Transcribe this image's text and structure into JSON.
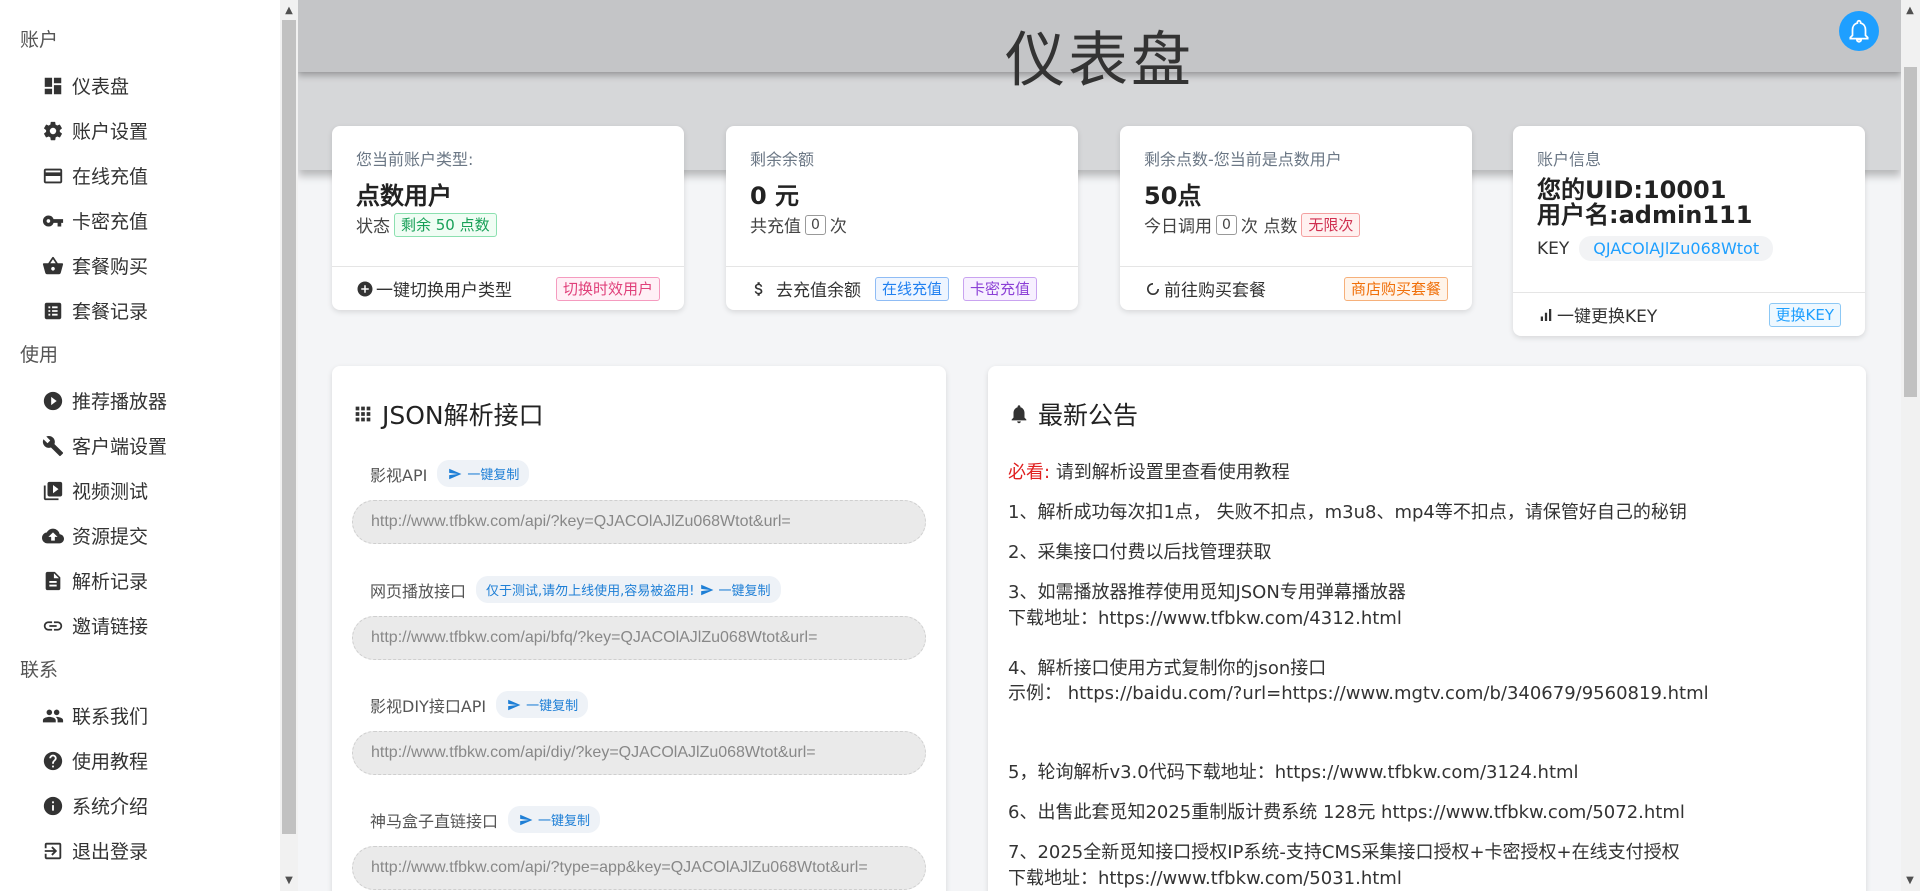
{
  "sidebar": {
    "sections": [
      {
        "label": "账户",
        "items": [
          {
            "label": "仪表盘",
            "icon": "dashboard-icon"
          },
          {
            "label": "账户设置",
            "icon": "gear-icon"
          },
          {
            "label": "在线充值",
            "icon": "credit-card-icon"
          },
          {
            "label": "卡密充值",
            "icon": "key-icon"
          },
          {
            "label": "套餐购买",
            "icon": "shopping-basket-icon"
          },
          {
            "label": "套餐记录",
            "icon": "list-icon"
          }
        ]
      },
      {
        "label": "使用",
        "items": [
          {
            "label": "推荐播放器",
            "icon": "play-circle-icon"
          },
          {
            "label": "客户端设置",
            "icon": "wrench-icon"
          },
          {
            "label": "视频测试",
            "icon": "video-library-icon"
          },
          {
            "label": "资源提交",
            "icon": "cloud-upload-icon"
          },
          {
            "label": "解析记录",
            "icon": "document-icon"
          },
          {
            "label": "邀请链接",
            "icon": "link-icon"
          }
        ]
      },
      {
        "label": "联系",
        "items": [
          {
            "label": "联系我们",
            "icon": "people-icon"
          },
          {
            "label": "使用教程",
            "icon": "help-circle-icon"
          },
          {
            "label": "系统介绍",
            "icon": "info-icon"
          },
          {
            "label": "退出登录",
            "icon": "logout-icon"
          }
        ]
      }
    ]
  },
  "header": {
    "title": "仪表盘",
    "bell_icon": "bell-icon"
  },
  "cards": {
    "type": {
      "caption": "您当前账户类型:",
      "value": "点数用户",
      "status_label": "状态",
      "status_tag": "剩余 50 点数",
      "action": "一键切换用户类型",
      "action_tag": "切换时效用户"
    },
    "balance": {
      "caption": "剩余余额",
      "value": "0 元",
      "line_prefix": "共充值",
      "count": "0",
      "line_suffix": "次",
      "action": "去充值余额",
      "tag1": "在线充值",
      "tag2": "卡密充值"
    },
    "points": {
      "caption": "剩余点数-您当前是点数用户",
      "value": "50点",
      "line_prefix": "今日调用",
      "count": "0",
      "line_suffix": "次 点数",
      "unlimited_tag": "无限次",
      "action": "前往购买套餐",
      "action_tag": "商店购买套餐"
    },
    "account": {
      "caption": "账户信息",
      "uid": "您的UID:10001",
      "username": "用户名:admin111",
      "key_label": "KEY",
      "key_value": "QJACOlAJlZu068Wtot",
      "action": "一键更换KEY",
      "action_tag": "更换KEY"
    }
  },
  "json_panel": {
    "title": "JSON解析接口",
    "copy_label": "一键复制",
    "apis": [
      {
        "label": "影视API",
        "note": "",
        "url": "http://www.tfbkw.com/api/?key=QJACOlAJlZu068Wtot&url="
      },
      {
        "label": "网页播放接口",
        "note": "仅于测试,请勿上线使用,容易被盗用!",
        "url": "http://www.tfbkw.com/api/bfq/?key=QJACOlAJlZu068Wtot&url="
      },
      {
        "label": "影视DIY接口API",
        "note": "",
        "url": "http://www.tfbkw.com/api/diy/?key=QJACOlAJlZu068Wtot&url="
      },
      {
        "label": "神马盒子直链接口",
        "note": "",
        "url": "http://www.tfbkw.com/api/?type=app&key=QJACOlAJlZu068Wtot&url="
      }
    ]
  },
  "announcements": {
    "title": "最新公告",
    "must_label": "必看:",
    "must_text": "请到解析设置里查看使用教程",
    "lines": [
      "1、解析成功每次扣1点， 失败不扣点，m3u8、mp4等不扣点，请保管好自己的秘钥",
      "2、采集接口付费以后找管理获取",
      "3、如需播放器推荐使用觅知JSON专用弹幕播放器",
      "下载地址：https://www.tfbkw.com/4312.html",
      "4、解析接口使用方式复制你的json接口",
      "示例： https://baidu.com/?url=https://www.mgtv.com/b/340679/9560819.html",
      "5，轮询解析v3.0代码下载地址：https://www.tfbkw.com/3124.html",
      "6、出售此套觅知2025重制版计费系统 128元 https://www.tfbkw.com/5072.html",
      "7、2025全新觅知接口授权IP系统-支持CMS采集接口授权+卡密授权+在线支付授权",
      "下载地址：https://www.tfbkw.com/5031.html"
    ]
  }
}
